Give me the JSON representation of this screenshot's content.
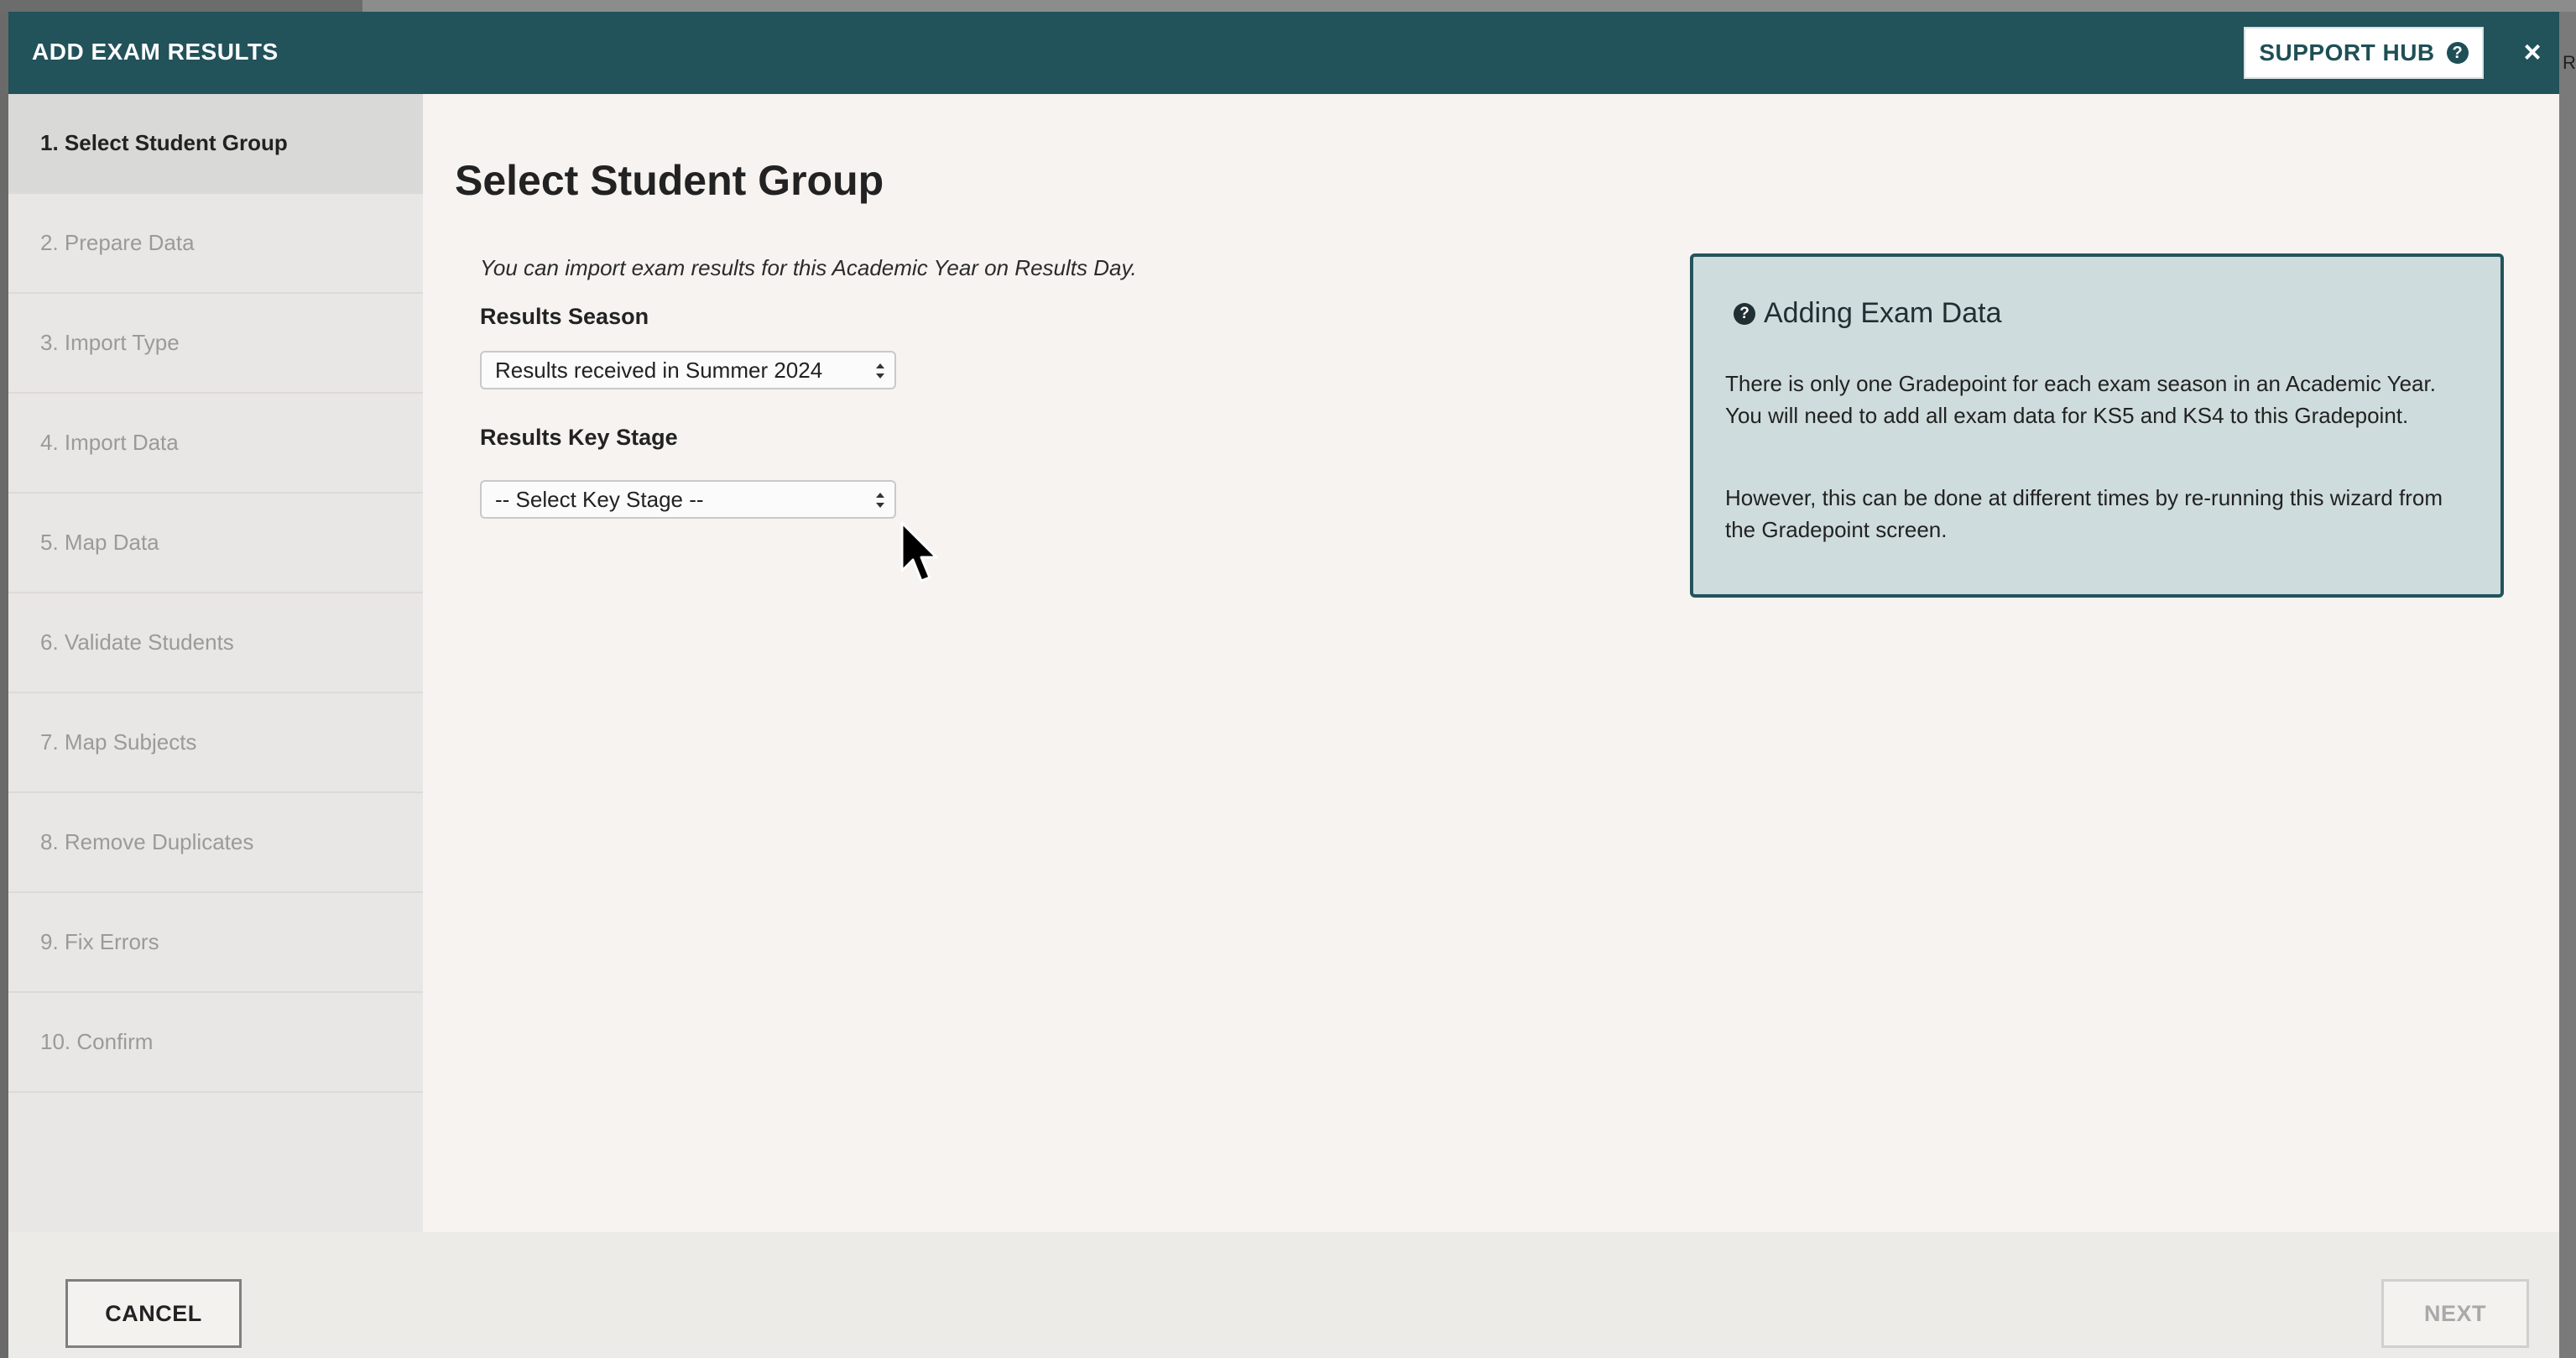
{
  "header": {
    "title": "ADD EXAM RESULTS",
    "support_hub_label": "SUPPORT HUB",
    "support_icon": "?",
    "close_glyph": "×"
  },
  "sidebar": {
    "steps": [
      {
        "label": "1. Select Student Group",
        "active": true
      },
      {
        "label": "2. Prepare Data",
        "active": false
      },
      {
        "label": "3. Import Type",
        "active": false
      },
      {
        "label": "4. Import Data",
        "active": false
      },
      {
        "label": "5. Map Data",
        "active": false
      },
      {
        "label": "6. Validate Students",
        "active": false
      },
      {
        "label": "7. Map Subjects",
        "active": false
      },
      {
        "label": "8. Remove Duplicates",
        "active": false
      },
      {
        "label": "9. Fix Errors",
        "active": false
      },
      {
        "label": "10. Confirm",
        "active": false
      }
    ]
  },
  "main": {
    "title": "Select Student Group",
    "note": "You can import exam results for this Academic Year on Results Day.",
    "results_season": {
      "label": "Results Season",
      "selected": "Results received in Summer 2024"
    },
    "results_key_stage": {
      "label": "Results Key Stage",
      "selected": "-- Select Key Stage --"
    }
  },
  "info_box": {
    "icon": "?",
    "title": "Adding Exam Data",
    "para1": "There is only one Gradepoint for each exam season in an Academic Year. You will need to add all exam data for KS5 and KS4 to this Gradepoint.",
    "para2": "However, this can be done at different times by re-running this wizard from the Gradepoint screen."
  },
  "footer": {
    "cancel_label": "CANCEL",
    "next_label": "NEXT"
  },
  "background": {
    "right_edge_char": "R"
  },
  "colors": {
    "header_bg": "#22525a",
    "accent": "#1f4f56",
    "info_bg": "#cfdcdd"
  }
}
